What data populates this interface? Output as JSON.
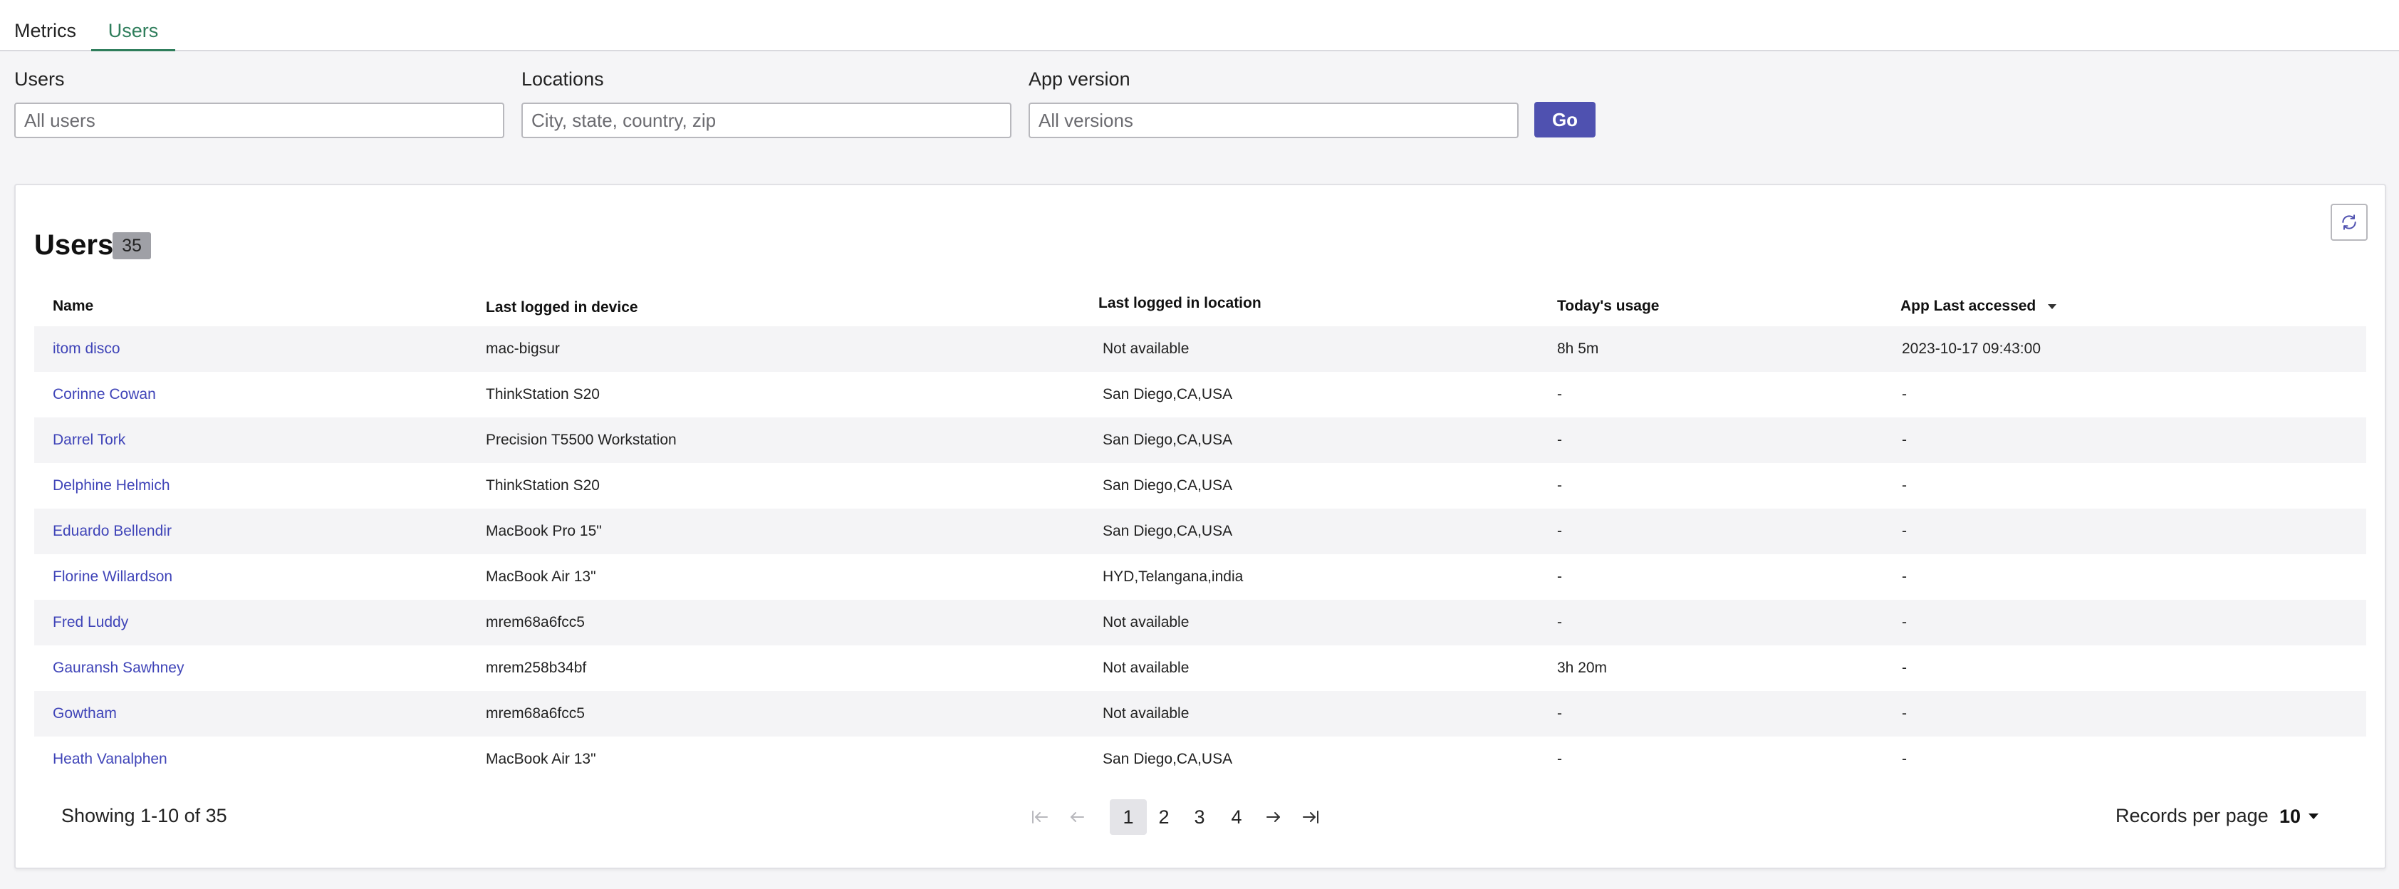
{
  "tabs": [
    {
      "label": "Metrics",
      "active": false
    },
    {
      "label": "Users",
      "active": true
    }
  ],
  "filters": {
    "users": {
      "label": "Users",
      "placeholder": "All users"
    },
    "locations": {
      "label": "Locations",
      "placeholder": "City, state, country, zip"
    },
    "app_version": {
      "label": "App version",
      "placeholder": "All versions"
    },
    "go_label": "Go"
  },
  "card": {
    "title": "Users",
    "count": "35"
  },
  "table": {
    "headers": {
      "name": "Name",
      "device": "Last logged in device",
      "location": "Last logged in location",
      "usage": "Today's usage",
      "last_accessed": "App Last accessed"
    },
    "rows": [
      {
        "name": "itom disco",
        "device": "mac-bigsur",
        "location": "Not available",
        "usage": "8h 5m",
        "last_accessed": "2023-10-17 09:43:00"
      },
      {
        "name": "Corinne Cowan",
        "device": "ThinkStation S20",
        "location": "San Diego,CA,USA",
        "usage": "-",
        "last_accessed": "-"
      },
      {
        "name": "Darrel Tork",
        "device": "Precision T5500 Workstation",
        "location": "San Diego,CA,USA",
        "usage": "-",
        "last_accessed": "-"
      },
      {
        "name": "Delphine Helmich",
        "device": "ThinkStation S20",
        "location": "San Diego,CA,USA",
        "usage": "-",
        "last_accessed": "-"
      },
      {
        "name": "Eduardo Bellendir",
        "device": "MacBook Pro 15\"",
        "location": "San Diego,CA,USA",
        "usage": "-",
        "last_accessed": "-"
      },
      {
        "name": "Florine Willardson",
        "device": "MacBook Air 13\"",
        "location": "HYD,Telangana,india",
        "usage": "-",
        "last_accessed": "-"
      },
      {
        "name": "Fred Luddy",
        "device": "mrem68a6fcc5",
        "location": "Not available",
        "usage": "-",
        "last_accessed": "-"
      },
      {
        "name": "Gauransh Sawhney",
        "device": "mrem258b34bf",
        "location": "Not available",
        "usage": "3h 20m",
        "last_accessed": "-"
      },
      {
        "name": "Gowtham",
        "device": "mrem68a6fcc5",
        "location": "Not available",
        "usage": "-",
        "last_accessed": "-"
      },
      {
        "name": "Heath Vanalphen",
        "device": "MacBook Air 13\"",
        "location": "San Diego,CA,USA",
        "usage": "-",
        "last_accessed": "-"
      }
    ]
  },
  "footer": {
    "showing": "Showing 1-10 of 35",
    "pages": [
      "1",
      "2",
      "3",
      "4"
    ],
    "current_page": "1",
    "records_per_page_label": "Records per page",
    "records_per_page_value": "10"
  },
  "colors": {
    "accent": "#4f51b0",
    "link": "#3f44b8",
    "active_tab": "#2e7d5b"
  }
}
